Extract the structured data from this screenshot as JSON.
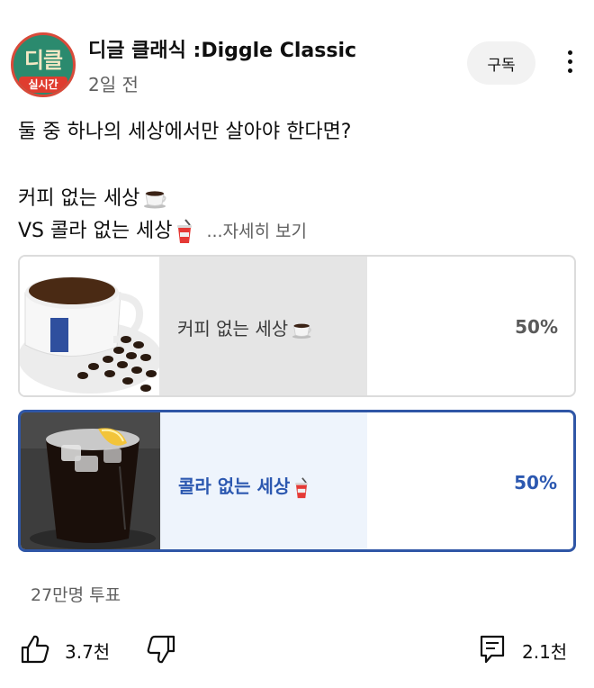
{
  "channel": {
    "avatar_text": "디클",
    "avatar_badge": "실시간",
    "name": "디글 클래식 :Diggle Classic",
    "posted": "2일 전",
    "subscribe_label": "구독"
  },
  "post": {
    "line1": "둘 중 하나의 세상에서만 살아야 한다면?",
    "line2": "커피 없는 세상",
    "line3": "VS 콜라 없는 세상",
    "more_label": "...자세히 보기"
  },
  "poll": {
    "options": [
      {
        "label": "커피 없는 세상",
        "percent": "50%",
        "fill_fraction": 0.5,
        "selected": false,
        "emoji": "coffee-cup-icon"
      },
      {
        "label": "콜라 없는 세상",
        "percent": "50%",
        "fill_fraction": 0.5,
        "selected": true,
        "emoji": "soda-cup-icon"
      }
    ],
    "votes": "27만명 투표"
  },
  "actions": {
    "like_count": "3.7천",
    "comment_count": "2.1천"
  },
  "colors": {
    "accent": "#2c58b0",
    "selected_border": "#2f56a6",
    "muted": "#606060"
  }
}
